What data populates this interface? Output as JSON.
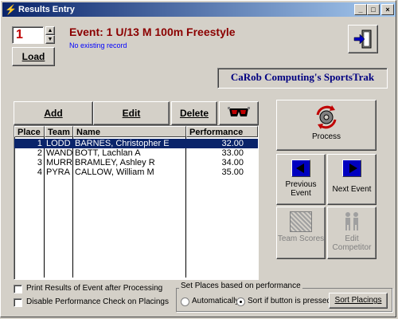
{
  "window": {
    "title": "Results Entry",
    "controls": {
      "minimize": "_",
      "maximize": "□",
      "close": "×"
    }
  },
  "load": {
    "value": "1",
    "label": "Load"
  },
  "event": {
    "title": "Event: 1 U/13  M  100m Freestyle",
    "record_status": "No existing record"
  },
  "brand": {
    "label": "CaRob Computing's SportsTrak"
  },
  "toolbar": {
    "add": "Add",
    "edit": "Edit",
    "delete": "Delete"
  },
  "table": {
    "columns": [
      "Place",
      "Team",
      "Name",
      "Performance"
    ],
    "rows": [
      {
        "place": "1",
        "team": "LODD",
        "name": "BARNES, Christopher E",
        "performance": "32.00",
        "selected": true
      },
      {
        "place": "2",
        "team": "WAND",
        "name": "BOTT, Lachlan A",
        "performance": "33.00",
        "selected": false
      },
      {
        "place": "3",
        "team": "MURR",
        "name": "BRAMLEY, Ashley R",
        "performance": "34.00",
        "selected": false
      },
      {
        "place": "4",
        "team": "PYRA",
        "name": "CALLOW, William M",
        "performance": "35.00",
        "selected": false
      }
    ]
  },
  "actions": {
    "process": "Process",
    "previous": "Previous Event",
    "next": "Next Event",
    "team_scores": "Team Scores",
    "edit_competitor": "Edit Competitor"
  },
  "options": {
    "print_results": "Print Results of Event after Processing",
    "disable_check": "Disable Performance Check on Placings"
  },
  "places": {
    "legend": "Set Places based on performance",
    "automatically": "Automatically",
    "sort_if_pressed": "Sort if button is pressed:",
    "sort_button": "Sort Placings",
    "selected_mode": "sort_if_pressed"
  },
  "colors": {
    "accent_red": "#8b0000",
    "brand_navy": "#000080",
    "selection": "#0a246a",
    "event_blue": "#0000ff"
  }
}
